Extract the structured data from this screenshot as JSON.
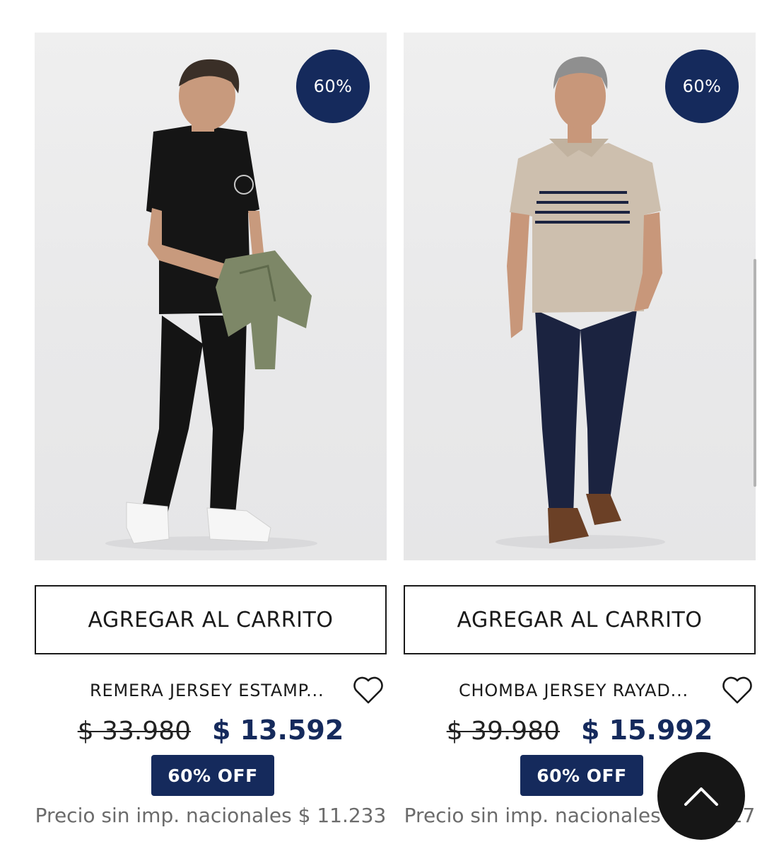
{
  "products": [
    {
      "discount_badge": "60%",
      "cart_button": "AGREGAR AL CARRITO",
      "name": "REMERA JERSEY ESTAMP...",
      "old_price": "$ 33.980",
      "new_price": "$ 13.592",
      "off_label": "60% OFF",
      "tax_note": "Precio sin imp. nacionales $ 11.233",
      "photo": "man-black-tshirt-holding-green-jacket"
    },
    {
      "discount_badge": "60%",
      "cart_button": "AGREGAR AL CARRITO",
      "name": "CHOMBA JERSEY RAYAD...",
      "old_price": "$ 39.980",
      "new_price": "$ 15.992",
      "off_label": "60% OFF",
      "tax_note": "Precio sin imp. nacionales $ 13.217",
      "photo": "man-beige-striped-polo-navy-pants"
    }
  ],
  "icons": {
    "favorite": "heart-icon",
    "back_to_top": "chevron-up-icon"
  },
  "colors": {
    "brand_navy": "#152a5c",
    "text": "#1a1a1a",
    "muted": "#6b6b6b",
    "fab": "#161616"
  }
}
